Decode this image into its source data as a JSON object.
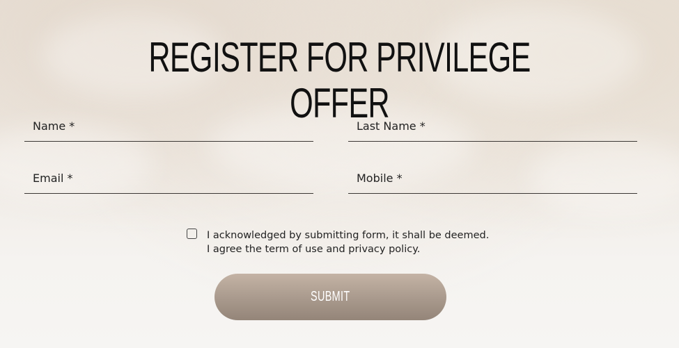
{
  "form": {
    "title": "REGISTER FOR PRIVILEGE OFFER",
    "fields": {
      "name": {
        "placeholder": "Name *",
        "value": ""
      },
      "last_name": {
        "placeholder": "Last Name *",
        "value": ""
      },
      "email": {
        "placeholder": "Email *",
        "value": ""
      },
      "mobile": {
        "placeholder": "Mobile *",
        "value": ""
      }
    },
    "consent": {
      "checked": false,
      "line1": "I acknowledged by submitting form, it shall be deemed.",
      "line2": "I agree the term of use and privacy policy."
    },
    "submit_label": "SUBMIT"
  },
  "colors": {
    "accent_button_top": "#c4b3a5",
    "accent_button_bottom": "#948579",
    "text": "#111111"
  }
}
